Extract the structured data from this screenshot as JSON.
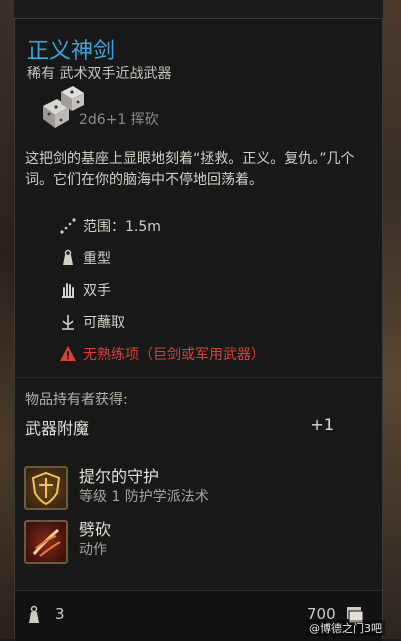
{
  "item": {
    "name": "正义神剑",
    "subtitle": "稀有 武术双手近战武器",
    "damage": "2d6+1 挥砍",
    "description": "这把剑的基座上显眼地刻着“拯救。正义。复仇。”几个词。它们在你的脑海中不停地回荡着。",
    "properties": [
      {
        "icon": "range-icon",
        "label": "范围：1.5m"
      },
      {
        "icon": "heavy-icon",
        "label": "重型"
      },
      {
        "icon": "two-handed-icon",
        "label": "双手"
      },
      {
        "icon": "dippable-icon",
        "label": "可蘸取"
      },
      {
        "icon": "warning-icon",
        "label": "无熟练项（巨剑或军用武器）"
      }
    ],
    "holder_gains_label": "物品持有者获得:",
    "enchantment": {
      "label": "武器附魔",
      "value": "+1"
    },
    "skills": [
      {
        "icon": "shield-spell-icon",
        "name": "提尔的守护",
        "sub": "等级 1 防护学派法术"
      },
      {
        "icon": "cleave-icon",
        "name": "劈砍",
        "sub": "动作"
      }
    ],
    "weight": "3",
    "price": "700"
  },
  "watermark": "@博德之门3吧",
  "colors": {
    "title": "#39a6df",
    "warning": "#d9423a",
    "panel": "#181818"
  }
}
